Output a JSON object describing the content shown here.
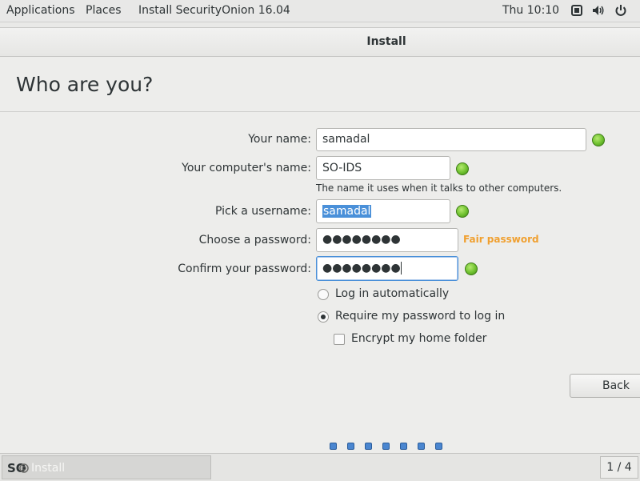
{
  "topbar": {
    "applications": "Applications",
    "places": "Places",
    "app_title": "Install SecurityOnion 16.04",
    "clock": "Thu 10:10",
    "icons": [
      "window-icon",
      "volume-icon",
      "power-icon"
    ]
  },
  "window": {
    "title": "Install",
    "heading": "Who are you?"
  },
  "form": {
    "name_label": "Your name:",
    "name_value": "samadal",
    "computer_label": "Your computer's name:",
    "computer_value": "SO-IDS",
    "computer_hint": "The name it uses when it talks to other computers.",
    "username_label": "Pick a username:",
    "username_value": "samadal",
    "password_label": "Choose a password:",
    "password_value": "●●●●●●●●",
    "password_strength": "Fair password",
    "confirm_label": "Confirm your password:",
    "confirm_value": "●●●●●●●●",
    "login_auto": "Log in automatically",
    "login_require": "Require my password to log in",
    "encrypt": "Encrypt my home folder",
    "selected_login": "Require my password to log in",
    "encrypt_checked": false
  },
  "buttons": {
    "back": "Back"
  },
  "progress": {
    "total_steps": 7
  },
  "taskbar": {
    "logo": "SO",
    "task": "Install",
    "workspace": "1 / 4"
  },
  "colors": {
    "accent": "#4a90d9",
    "ok": "#6fc12f",
    "strength": "#f0a030"
  }
}
